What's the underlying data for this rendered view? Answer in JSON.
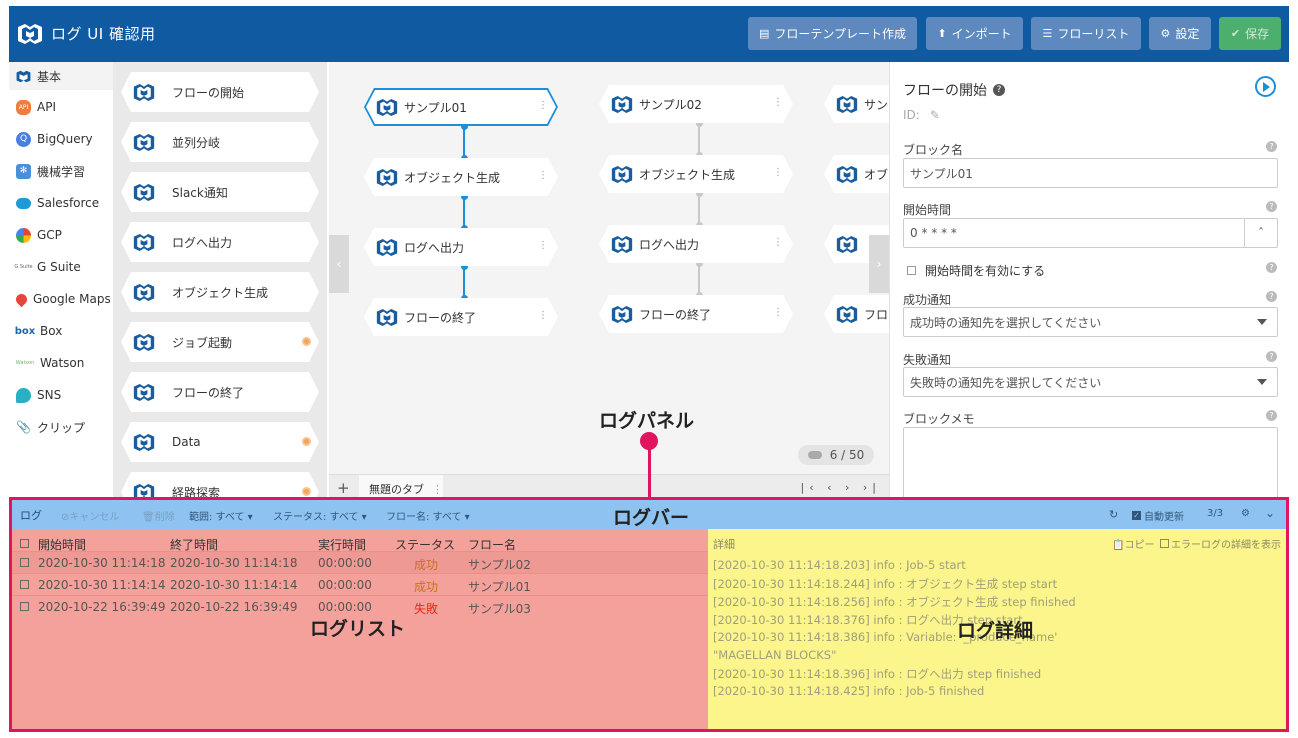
{
  "app": {
    "title": "ログ UI 確認用"
  },
  "header_buttons": [
    {
      "label": "フローテンプレート作成",
      "icon": "document-icon"
    },
    {
      "label": "インポート",
      "icon": "upload-icon"
    },
    {
      "label": "フローリスト",
      "icon": "list-icon"
    },
    {
      "label": "設定",
      "icon": "gear-icon"
    },
    {
      "label": "保存",
      "icon": "check-circle-icon"
    }
  ],
  "categories": [
    {
      "label": "基本",
      "icon": "magellan-cube-icon",
      "selected": true
    },
    {
      "label": "API",
      "icon": "api-icon"
    },
    {
      "label": "BigQuery",
      "icon": "bigquery-icon"
    },
    {
      "label": "機械学習",
      "icon": "machine-learning-icon"
    },
    {
      "label": "Salesforce",
      "icon": "salesforce-icon"
    },
    {
      "label": "GCP",
      "icon": "gcp-icon"
    },
    {
      "label": "G Suite",
      "icon": "gsuite-icon"
    },
    {
      "label": "Google Maps",
      "icon": "map-pin-icon"
    },
    {
      "label": "Box",
      "icon": "box-icon"
    },
    {
      "label": "Watson",
      "icon": "watson-icon"
    },
    {
      "label": "SNS",
      "icon": "chat-bubble-icon"
    },
    {
      "label": "クリップ",
      "icon": "paperclip-icon"
    }
  ],
  "palette": [
    {
      "label": "フローの開始"
    },
    {
      "label": "並列分岐"
    },
    {
      "label": "Slack通知"
    },
    {
      "label": "ログへ出力"
    },
    {
      "label": "オブジェクト生成"
    },
    {
      "label": "ジョブ起動",
      "badge": true
    },
    {
      "label": "フローの終了"
    },
    {
      "label": "Data",
      "badge": true
    },
    {
      "label": "経路探索",
      "badge": true
    }
  ],
  "flows": [
    [
      "サンプル01",
      "オブジェクト生成",
      "ログへ出力",
      "フローの終了"
    ],
    [
      "サンプル02",
      "オブジェクト生成",
      "ログへ出力",
      "フローの終了"
    ],
    [
      "サン",
      "オブ",
      "",
      "フロ"
    ]
  ],
  "canvas": {
    "counter": "6 / 50"
  },
  "tabs": {
    "add": "+",
    "active": "無題のタブ",
    "menu": "⋮",
    "nav": "|‹ ‹ › ›|"
  },
  "properties": {
    "title": "フローの開始",
    "id_label": "ID:",
    "block_name_label": "ブロック名",
    "block_name_value": "サンプル01",
    "start_time_label": "開始時間",
    "start_time_value": "0 * * * *",
    "enable_start_label": "開始時間を有効にする",
    "success_label": "成功通知",
    "success_placeholder": "成功時の通知先を選択してください",
    "failure_label": "失敗通知",
    "failure_placeholder": "失敗時の通知先を選択してください",
    "memo_label": "ブロックメモ"
  },
  "logbar": {
    "title": "ログ",
    "cancel": "キャンセル",
    "delete": "削除",
    "range": "範囲: すべて",
    "status": "ステータス: すべて",
    "flow_name": "フロー名: すべて",
    "auto_refresh": "自動更新",
    "count": "3/3"
  },
  "loglist": {
    "columns": [
      "開始時間",
      "終了時間",
      "実行時間",
      "ステータス",
      "フロー名"
    ],
    "rows": [
      {
        "start": "2020-10-30 11:14:18",
        "end": "2020-10-30 11:14:18",
        "elapsed": "00:00:00",
        "status": "成功",
        "status_color": "#c8701f",
        "flow": "サンプル02"
      },
      {
        "start": "2020-10-30 11:14:14",
        "end": "2020-10-30 11:14:14",
        "elapsed": "00:00:00",
        "status": "成功",
        "status_color": "#c8701f",
        "flow": "サンプル01"
      },
      {
        "start": "2020-10-22 16:39:49",
        "end": "2020-10-22 16:39:49",
        "elapsed": "00:00:00",
        "status": "失敗",
        "status_color": "#e8261a",
        "flow": "サンプル03"
      }
    ]
  },
  "logdetail": {
    "title": "詳細",
    "copy": "コピー",
    "show_error": "エラーログの詳細を表示",
    "lines": [
      "[2020-10-30 11:14:18.203]  info : Job-5 start",
      "[2020-10-30 11:14:18.244]  info : オブジェクト生成 step start",
      "[2020-10-30 11:14:18.256]  info : オブジェクト生成 step finished",
      "[2020-10-30 11:14:18.376]  info : ログへ出力 step start",
      "[2020-10-30 11:14:18.386]  info : Variable: '_produce_name'",
      "\"MAGELLAN BLOCKS\"",
      "[2020-10-30 11:14:18.396]  info : ログへ出力 step finished",
      "[2020-10-30 11:14:18.425]  info : Job-5 finished"
    ]
  },
  "annotations": {
    "log_panel": "ログパネル",
    "log_bar": "ログバー",
    "log_list": "ログリスト",
    "log_detail": "ログ詳細"
  },
  "colors": {
    "header": "#0f5aa1",
    "accent": "#e0155f",
    "selected_node": "#1c8fd8",
    "save_button": "#4caf6e"
  }
}
